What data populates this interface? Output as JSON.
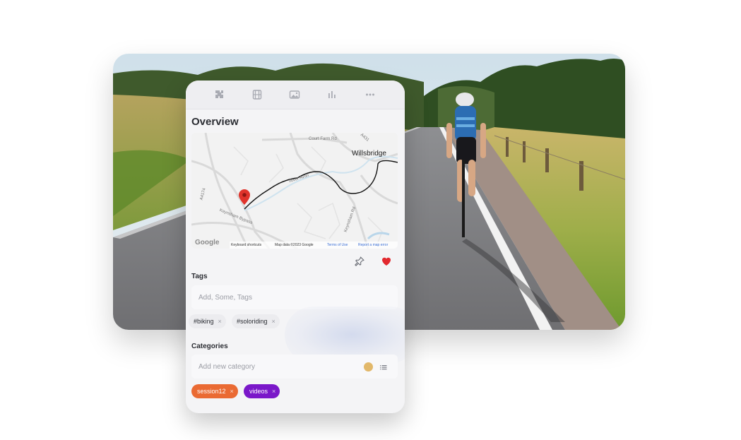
{
  "toolbar": {
    "buttons": [
      {
        "icon": "puzzle-icon"
      },
      {
        "icon": "film-icon"
      },
      {
        "icon": "photo-icon"
      },
      {
        "icon": "bar-chart-icon"
      },
      {
        "icon": "more-icon"
      }
    ]
  },
  "overview": {
    "title": "Overview",
    "map": {
      "place_labels": {
        "willsbridge": "Willsbridge",
        "court_farm_rd": "Court Farm Rd",
        "river_avon": "River Avon",
        "a4174": "A4174",
        "keynsham_bypass": "Keynsham Bypass",
        "keynsham_rd": "Keynsham Rd",
        "a431": "A431"
      },
      "google_logo": "Google",
      "footer": {
        "keyboard_shortcuts": "Keyboard shortcuts",
        "map_data": "Map data ©2023 Google",
        "terms": "Terms of Use",
        "report": "Report a map error"
      },
      "colors": {
        "route": "#111111",
        "pin": "#e0332b",
        "road": "#dcdcdc"
      }
    }
  },
  "actions": {
    "pin_icon": "pin-icon",
    "favorite_icon": "heart-icon",
    "favorite_color": "#e2292f"
  },
  "tags": {
    "label": "Tags",
    "input_placeholder": "Add, Some, Tags",
    "items": [
      {
        "text": "#biking",
        "remove": "×"
      },
      {
        "text": "#soloriding",
        "remove": "×"
      }
    ]
  },
  "categories": {
    "label": "Categories",
    "input_placeholder": "Add new category",
    "color_swatch": "#e2b86a",
    "list_icon": "list-icon",
    "items": [
      {
        "text": "session12",
        "remove": "×",
        "color": "#ea6a33"
      },
      {
        "text": "videos",
        "remove": "×",
        "color": "#7a17c9"
      }
    ]
  }
}
